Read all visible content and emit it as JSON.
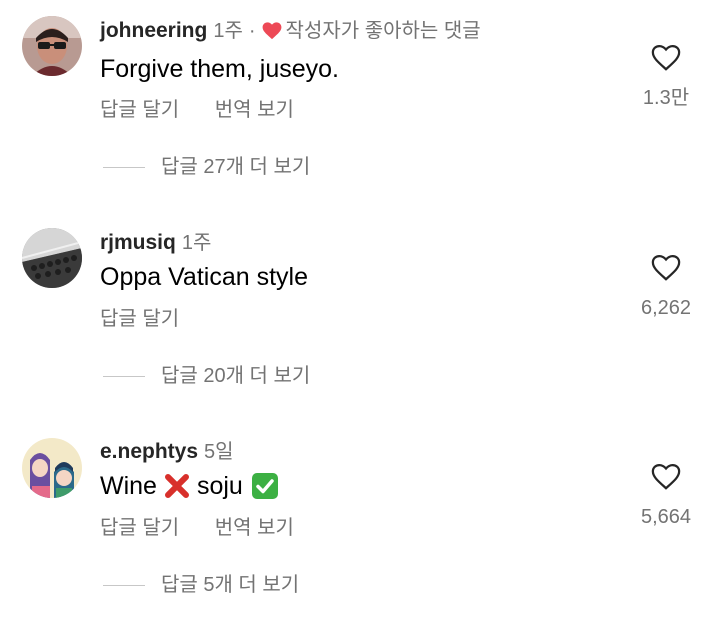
{
  "comments": [
    {
      "username": "johneering",
      "time": "1주",
      "separator": "·",
      "liked_by_author_text": "작성자가 좋아하는 댓글",
      "text": "Forgive them, juseyo.",
      "actions": [
        "답글 달기",
        "번역 보기"
      ],
      "view_replies": "답글 27개 더 보기",
      "like_count": "1.3만",
      "avatar_icon": "profile-photo-icon"
    },
    {
      "username": "rjmusiq",
      "time": "1주",
      "text": "Oppa Vatican style",
      "actions": [
        "답글 달기"
      ],
      "view_replies": "답글 20개 더 보기",
      "like_count": "6,262",
      "avatar_icon": "profile-photo-icon"
    },
    {
      "username": "e.nephtys",
      "time": "5일",
      "text_before": "Wine",
      "text_middle": "soju",
      "actions": [
        "답글 달기",
        "번역 보기"
      ],
      "view_replies": "답글 5개 더 보기",
      "like_count": "5,664",
      "avatar_icon": "profile-photo-icon",
      "emojis": [
        "cross-mark-emoji",
        "check-mark-emoji"
      ]
    }
  ],
  "colors": {
    "primary_text": "#000000",
    "username": "#262626",
    "secondary_text": "#737373",
    "liked_heart": "#ed4956",
    "divider": "#c7c7c7",
    "check_green": "#3cb043",
    "cross_red": "#d8302b"
  }
}
